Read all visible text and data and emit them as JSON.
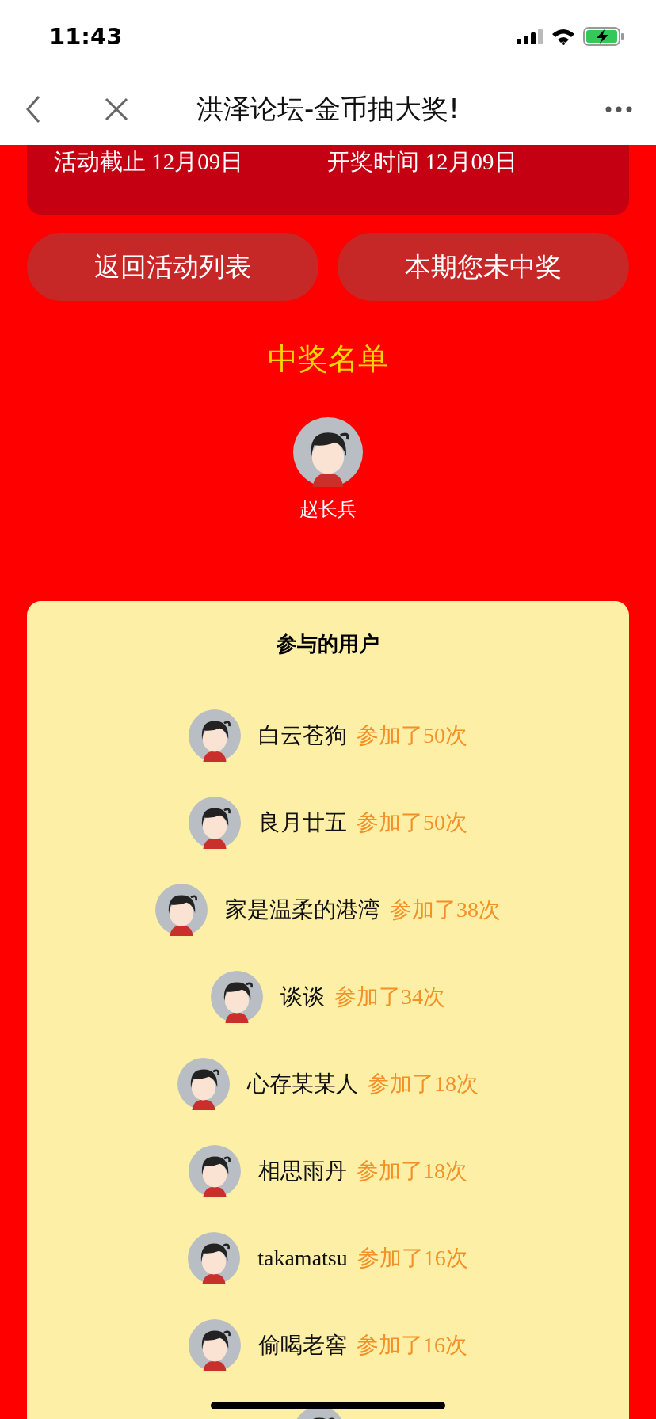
{
  "status_bar": {
    "time": "11:43"
  },
  "nav_bar": {
    "title": "洪泽论坛-金币抽大奖!"
  },
  "info_card": {
    "items": [
      {
        "label": "活动截止",
        "value": "12月09日"
      },
      {
        "label": "开奖时间",
        "value": "12月09日"
      }
    ]
  },
  "buttons": [
    {
      "label": "返回活动列表"
    },
    {
      "label": "本期您未中奖"
    }
  ],
  "winners": {
    "title": "中奖名单",
    "people": [
      {
        "name": "赵长兵"
      }
    ]
  },
  "participants": {
    "title": "参与的用户",
    "rows": [
      {
        "name": "白云苍狗",
        "count": "参加了50次"
      },
      {
        "name": "良月廿五",
        "count": "参加了50次"
      },
      {
        "name": "家是温柔的港湾",
        "count": "参加了38次"
      },
      {
        "name": "谈谈",
        "count": "参加了34次"
      },
      {
        "name": "心存某某人",
        "count": "参加了18次"
      },
      {
        "name": "相思雨丹",
        "count": "参加了18次"
      },
      {
        "name": "takamatsu",
        "count": "参加了16次"
      },
      {
        "name": "偷喝老窖",
        "count": "参加了16次"
      }
    ],
    "more_below": true
  }
}
